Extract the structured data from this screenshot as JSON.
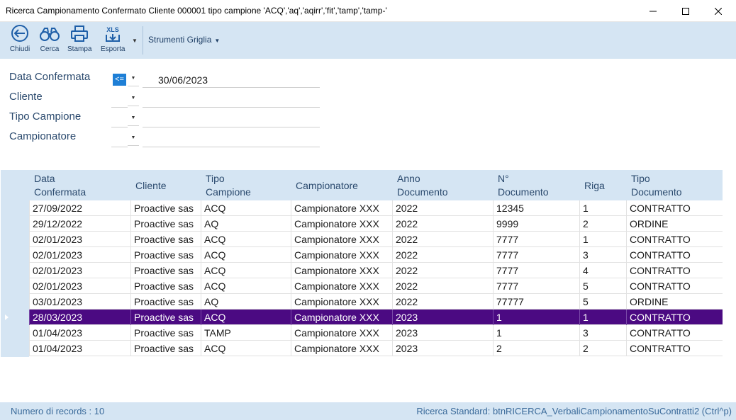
{
  "window": {
    "title": "Ricerca Campionamento Confermato Cliente 000001 tipo campione 'ACQ','aq','aqirr','fit','tamp','tamp-'"
  },
  "toolbar": {
    "buttons": [
      {
        "label": "Chiudi",
        "icon": "back-arrow-icon"
      },
      {
        "label": "Cerca",
        "icon": "binoculars-icon"
      },
      {
        "label": "Stampa",
        "icon": "printer-icon"
      },
      {
        "label": "Esporta",
        "icon": "xls-export-icon",
        "icon_text": "XLS"
      }
    ],
    "tools_label": "Strumenti Griglia"
  },
  "filters": {
    "data_confermata": {
      "label": "Data Confermata",
      "operator": "<=",
      "value": "30/06/2023"
    },
    "cliente": {
      "label": "Cliente",
      "operator": "",
      "value": ""
    },
    "tipo_campione": {
      "label": "Tipo Campione",
      "operator": "",
      "value": ""
    },
    "campionatore": {
      "label": "Campionatore",
      "operator": "",
      "value": ""
    }
  },
  "grid": {
    "headers": [
      [
        "Data",
        "Confermata"
      ],
      [
        "Cliente",
        ""
      ],
      [
        "Tipo",
        "Campione"
      ],
      [
        "Campionatore",
        ""
      ],
      [
        "Anno",
        "Documento"
      ],
      [
        "N°",
        "Documento"
      ],
      [
        "Riga",
        ""
      ],
      [
        "Tipo",
        "Documento"
      ]
    ],
    "selected_row_index": 7,
    "rows": [
      [
        "27/09/2022",
        "Proactive sas",
        "ACQ",
        "Campionatore XXX",
        "2022",
        "12345",
        "1",
        "CONTRATTO"
      ],
      [
        "29/12/2022",
        "Proactive sas",
        "AQ",
        "Campionatore XXX",
        "2022",
        "9999",
        "2",
        "ORDINE"
      ],
      [
        "02/01/2023",
        "Proactive sas",
        "ACQ",
        "Campionatore XXX",
        "2022",
        "7777",
        "1",
        "CONTRATTO"
      ],
      [
        "02/01/2023",
        "Proactive sas",
        "ACQ",
        "Campionatore XXX",
        "2022",
        "7777",
        "3",
        "CONTRATTO"
      ],
      [
        "02/01/2023",
        "Proactive sas",
        "ACQ",
        "Campionatore XXX",
        "2022",
        "7777",
        "4",
        "CONTRATTO"
      ],
      [
        "02/01/2023",
        "Proactive sas",
        "ACQ",
        "Campionatore XXX",
        "2022",
        "7777",
        "5",
        "CONTRATTO"
      ],
      [
        "03/01/2023",
        "Proactive sas",
        "AQ",
        "Campionatore XXX",
        "2022",
        "77777",
        "5",
        "ORDINE"
      ],
      [
        "28/03/2023",
        "Proactive sas",
        "ACQ",
        "Campionatore XXX",
        "2023",
        "1",
        "1",
        "CONTRATTO"
      ],
      [
        "01/04/2023",
        "Proactive sas",
        "TAMP",
        "Campionatore XXX",
        "2023",
        "1",
        "3",
        "CONTRATTO"
      ],
      [
        "01/04/2023",
        "Proactive sas",
        "ACQ",
        "Campionatore XXX",
        "2023",
        "2",
        "2",
        "CONTRATTO"
      ]
    ]
  },
  "status": {
    "records": "Numero di records : 10",
    "search": "Ricerca Standard: btnRICERCA_VerbaliCampionamentoSuContratti2 (Ctrl^p)"
  },
  "colors": {
    "toolbar_bg": "#d5e5f3",
    "selected_row": "#4b0a82",
    "operator_active": "#1e7fd6"
  }
}
